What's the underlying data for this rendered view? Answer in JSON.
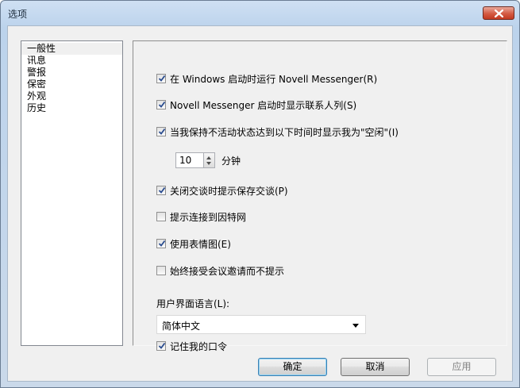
{
  "window": {
    "title": "选项",
    "close_icon": "close-icon"
  },
  "nav": {
    "items": [
      "一般性",
      "讯息",
      "警报",
      "保密",
      "外观",
      "历史"
    ],
    "selected": 0
  },
  "options": {
    "run_on_startup": {
      "label": "在 Windows 启动时运行 Novell Messenger(R)",
      "checked": true
    },
    "show_contacts": {
      "label": "Novell Messenger 启动时显示联系人列(S)",
      "checked": true
    },
    "idle_status": {
      "label": "当我保持不活动状态达到以下时间时显示我为\"空闲\"(I)",
      "checked": true
    },
    "idle_minutes": {
      "value": "10",
      "unit": "分钟"
    },
    "prompt_save": {
      "label": "关闭交谈时提示保存交谈(P)",
      "checked": true
    },
    "prompt_internet": {
      "label": "提示连接到因特网",
      "checked": false
    },
    "use_emoticons": {
      "label": "使用表情图(E)",
      "checked": true
    },
    "accept_invites": {
      "label": "始终接受会议邀请而不提示",
      "checked": false
    },
    "ui_language": {
      "label": "用户界面语言(L):",
      "value": "简体中文"
    },
    "remember_password": {
      "label": "记住我的口令",
      "checked": true
    }
  },
  "buttons": {
    "ok": "确定",
    "cancel": "取消",
    "apply": "应用"
  },
  "colors": {
    "titlebar": "#bcd3ec",
    "close": "#c9432b",
    "dialog_bg": "#f0f0f0"
  }
}
